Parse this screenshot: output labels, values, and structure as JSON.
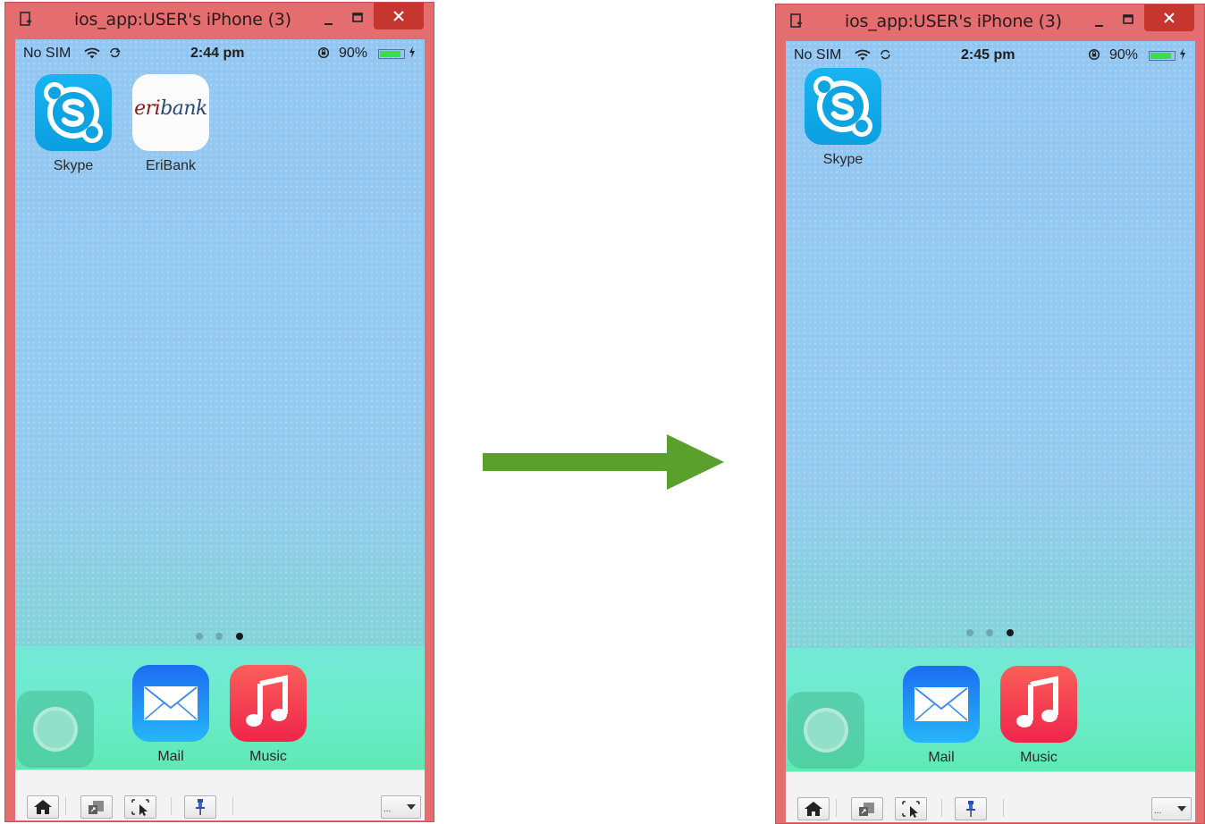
{
  "before": {
    "window_title": "ios_app:USER's iPhone (3)",
    "status": {
      "carrier": "No SIM",
      "time": "2:44 pm",
      "battery": "90%",
      "battery_level": 0.9
    },
    "home_apps": [
      {
        "label": "Skype",
        "icon": "skype-icon"
      },
      {
        "label": "EriBank",
        "icon": "eribank-icon",
        "logo_text": "eribank"
      }
    ],
    "page_indicator": {
      "pages": 3,
      "current": 3
    },
    "dock_apps": [
      {
        "label": "Mail",
        "icon": "mail-icon"
      },
      {
        "label": "Music",
        "icon": "music-icon"
      }
    ],
    "toolbar": {
      "more": "..."
    }
  },
  "after": {
    "window_title": "ios_app:USER's iPhone (3)",
    "status": {
      "carrier": "No SIM",
      "time": "2:45 pm",
      "battery": "90%",
      "battery_level": 0.9
    },
    "home_apps": [
      {
        "label": "Skype",
        "icon": "skype-icon"
      }
    ],
    "page_indicator": {
      "pages": 3,
      "current": 3
    },
    "dock_apps": [
      {
        "label": "Mail",
        "icon": "mail-icon"
      },
      {
        "label": "Music",
        "icon": "music-icon"
      }
    ],
    "toolbar": {
      "more": "..."
    }
  },
  "colors": {
    "window_frame": "#e46d70",
    "close_button": "#c7352f",
    "arrow": "#5aa02c",
    "skype": "#0b9fe0",
    "eribank_red": "#8b1a1a",
    "eribank_blue": "#27497e"
  }
}
